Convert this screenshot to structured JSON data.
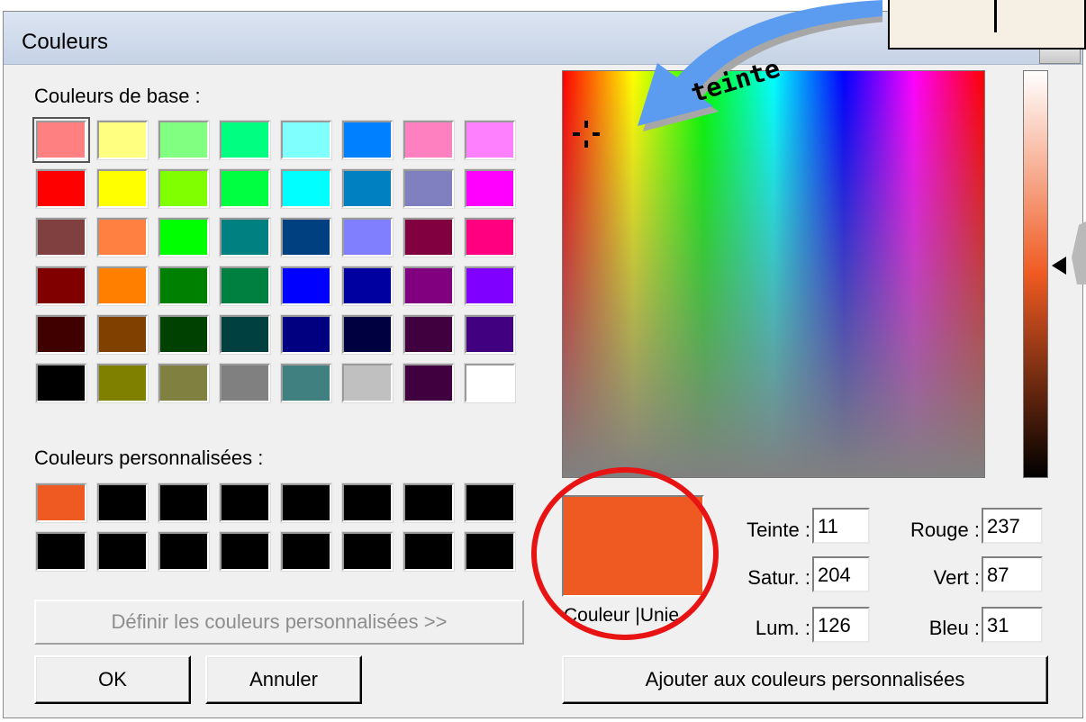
{
  "window": {
    "title": "Couleurs"
  },
  "base_colors": {
    "label": "Couleurs de base :",
    "swatches": [
      "#ff8080",
      "#ffff80",
      "#80ff80",
      "#00ff80",
      "#80ffff",
      "#0080ff",
      "#ff80c0",
      "#ff80ff",
      "#ff0000",
      "#ffff00",
      "#80ff00",
      "#00ff40",
      "#00ffff",
      "#0080c0",
      "#8080c0",
      "#ff00ff",
      "#804040",
      "#ff8040",
      "#00ff00",
      "#008080",
      "#004080",
      "#8080ff",
      "#800040",
      "#ff0080",
      "#800000",
      "#ff8000",
      "#008000",
      "#008040",
      "#0000ff",
      "#0000a0",
      "#800080",
      "#8000ff",
      "#400000",
      "#804000",
      "#004000",
      "#004040",
      "#000080",
      "#000040",
      "#400040",
      "#400080",
      "#000000",
      "#808000",
      "#808040",
      "#808080",
      "#408080",
      "#c0c0c0",
      "#400040",
      "#ffffff"
    ]
  },
  "custom_colors": {
    "label": "Couleurs personnalisées :",
    "swatches": [
      "#ef5a22",
      "#000000",
      "#000000",
      "#000000",
      "#000000",
      "#000000",
      "#000000",
      "#000000",
      "#000000",
      "#000000",
      "#000000",
      "#000000",
      "#000000",
      "#000000",
      "#000000",
      "#000000"
    ]
  },
  "buttons": {
    "define_custom": "Définir les couleurs personnalisées >>",
    "ok": "OK",
    "cancel": "Annuler",
    "add_custom": "Ajouter aux couleurs personnalisées"
  },
  "preview": {
    "label": "Couleur |Unie",
    "color": "#ef5a22"
  },
  "fields": {
    "hue": {
      "label": "Teinte :",
      "value": "11"
    },
    "sat": {
      "label": "Satur. :",
      "value": "204"
    },
    "lum": {
      "label": "Lum. :",
      "value": "126"
    },
    "red": {
      "label": "Rouge :",
      "value": "237"
    },
    "green": {
      "label": "Vert :",
      "value": "87"
    },
    "blue": {
      "label": "Bleu :",
      "value": "31"
    }
  },
  "annotation": {
    "arrow_text": "teinte",
    "arrow_color": "#5b9bf0",
    "circle_color": "#e81414"
  }
}
